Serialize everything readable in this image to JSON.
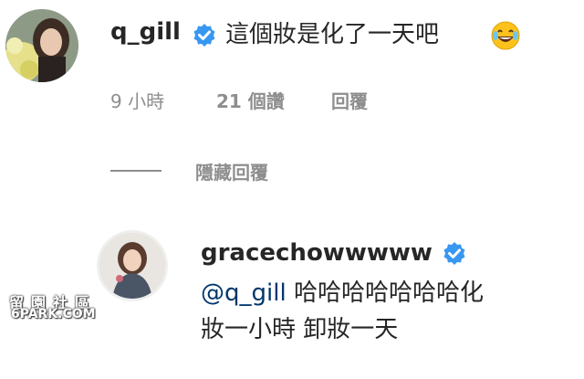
{
  "comment": {
    "username": "q_gill",
    "text": "這個妝是化了一天吧",
    "emoji": "laughing-tears-emoji",
    "time": "9 小時",
    "likes": "21 個讚",
    "reply_label": "回覆",
    "hide_replies_label": "隱藏回覆"
  },
  "reply": {
    "username": "gracechowwwww",
    "mention": "@q_gill",
    "text_line1": "哈哈哈哈哈哈哈化",
    "text_line2": "妝一小時 卸妝一天"
  },
  "watermark": {
    "cn": "留園社區",
    "en": "6PARK.COM"
  },
  "colors": {
    "verified": "#3897f0",
    "mention": "#00376b",
    "meta": "#8e8e8e"
  }
}
